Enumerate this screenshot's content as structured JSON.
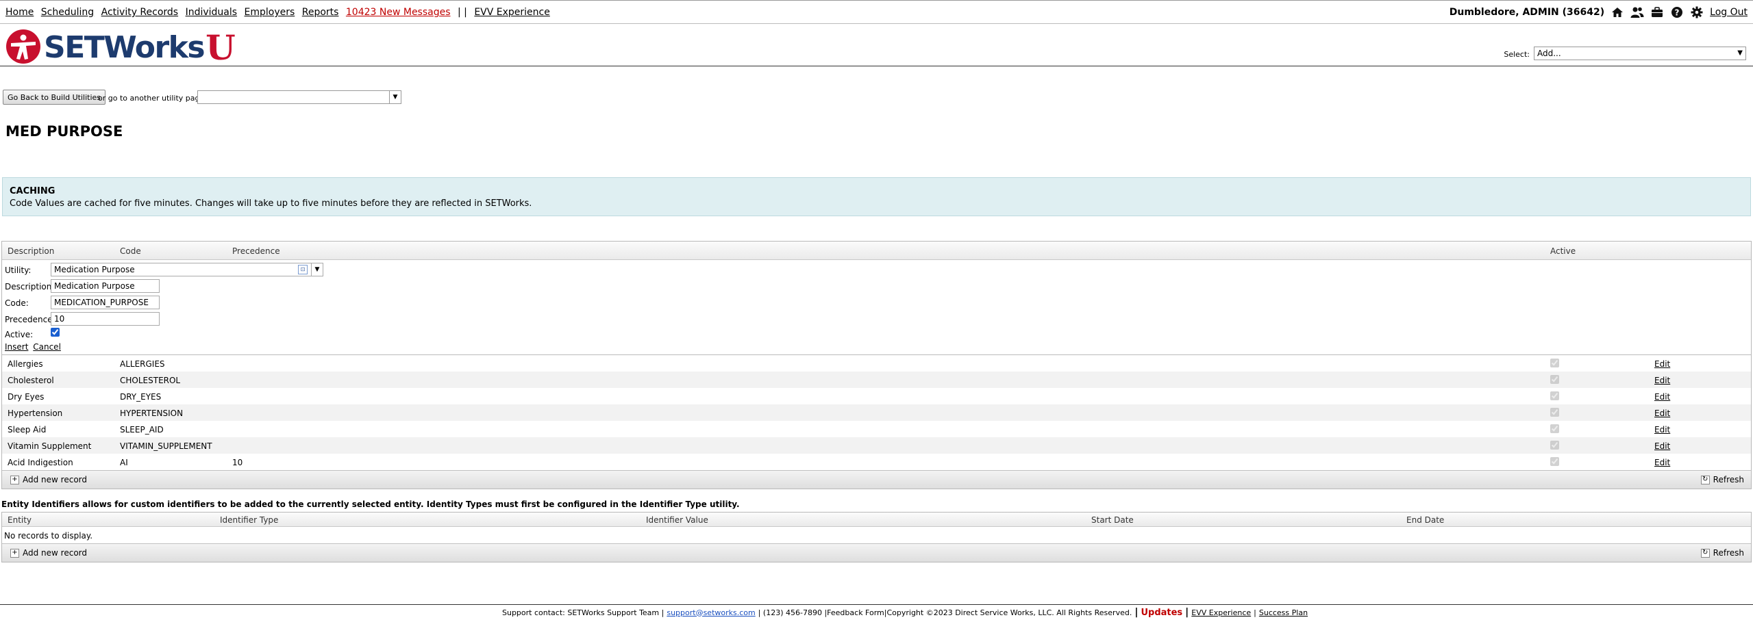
{
  "nav": {
    "links": [
      "Home",
      "Scheduling",
      "Activity Records",
      "Individuals",
      "Employers",
      "Reports"
    ],
    "messages": "10423 New Messages",
    "separator": "| |",
    "evv": "EVV Experience"
  },
  "user": {
    "name": "Dumbledore, ADMIN (36642)",
    "logout": "Log Out"
  },
  "header": {
    "logo_main": "SETWorks",
    "logo_u": "U",
    "select_label": "Select:",
    "select_value": "Add..."
  },
  "utility_nav": {
    "back_button": "Go Back to Build Utilities",
    "goto_label": "or go to another utility page:",
    "goto_value": ""
  },
  "page_title": "MED PURPOSE",
  "caching": {
    "title": "CACHING",
    "text": "Code Values are cached for five minutes. Changes will take up to five minutes before they are reflected in SETWorks."
  },
  "code_grid": {
    "columns": {
      "description": "Description",
      "code": "Code",
      "precedence": "Precedence",
      "active": "Active"
    },
    "edit_form": {
      "utility_label": "Utility:",
      "utility_value": "Medication Purpose",
      "description_label": "Description:",
      "description_value": "Medication Purpose",
      "code_label": "Code:",
      "code_value": "MEDICATION_PURPOSE",
      "precedence_label": "Precedence:",
      "precedence_value": "10",
      "active_label": "Active:",
      "insert": "Insert",
      "cancel": "Cancel"
    },
    "rows": [
      {
        "description": "Allergies",
        "code": "ALLERGIES",
        "precedence": "",
        "active": true,
        "edit": "Edit"
      },
      {
        "description": "Cholesterol",
        "code": "CHOLESTEROL",
        "precedence": "",
        "active": true,
        "edit": "Edit"
      },
      {
        "description": "Dry Eyes",
        "code": "DRY_EYES",
        "precedence": "",
        "active": true,
        "edit": "Edit"
      },
      {
        "description": "Hypertension",
        "code": "HYPERTENSION",
        "precedence": "",
        "active": true,
        "edit": "Edit"
      },
      {
        "description": "Sleep Aid",
        "code": "SLEEP_AID",
        "precedence": "",
        "active": true,
        "edit": "Edit"
      },
      {
        "description": "Vitamin Supplement",
        "code": "VITAMIN_SUPPLEMENT",
        "precedence": "",
        "active": true,
        "edit": "Edit"
      },
      {
        "description": "Acid Indigestion",
        "code": "AI",
        "precedence": "10",
        "active": true,
        "edit": "Edit"
      }
    ],
    "add_record": "Add new record",
    "refresh": "Refresh"
  },
  "entity": {
    "description": "Entity Identifiers allows for custom identifiers to be added to the currently selected entity. Identity Types must first be configured in the Identifier Type utility.",
    "columns": {
      "entity": "Entity",
      "identifier_type": "Identifier Type",
      "identifier_value": "Identifier Value",
      "start_date": "Start Date",
      "end_date": "End Date"
    },
    "no_records": "No records to display.",
    "add_record": "Add new record",
    "refresh": "Refresh"
  },
  "footer": {
    "support": "Support contact: SETWorks Support Team |",
    "email": "support@setworks.com",
    "phone_feedback_copyright": "| (123) 456-7890 |Feedback Form|Copyright ©2023 Direct Service Works, LLC. All Rights Reserved.",
    "bar": "|",
    "updates": "Updates",
    "evv": "EVV Experience",
    "pipe": "|",
    "success": "Success Plan"
  },
  "colors": {
    "brand_red": "#c8102e",
    "brand_blue": "#1d3b6e",
    "info_bg": "#dfeff2",
    "link_blue": "#1a4fbf"
  }
}
